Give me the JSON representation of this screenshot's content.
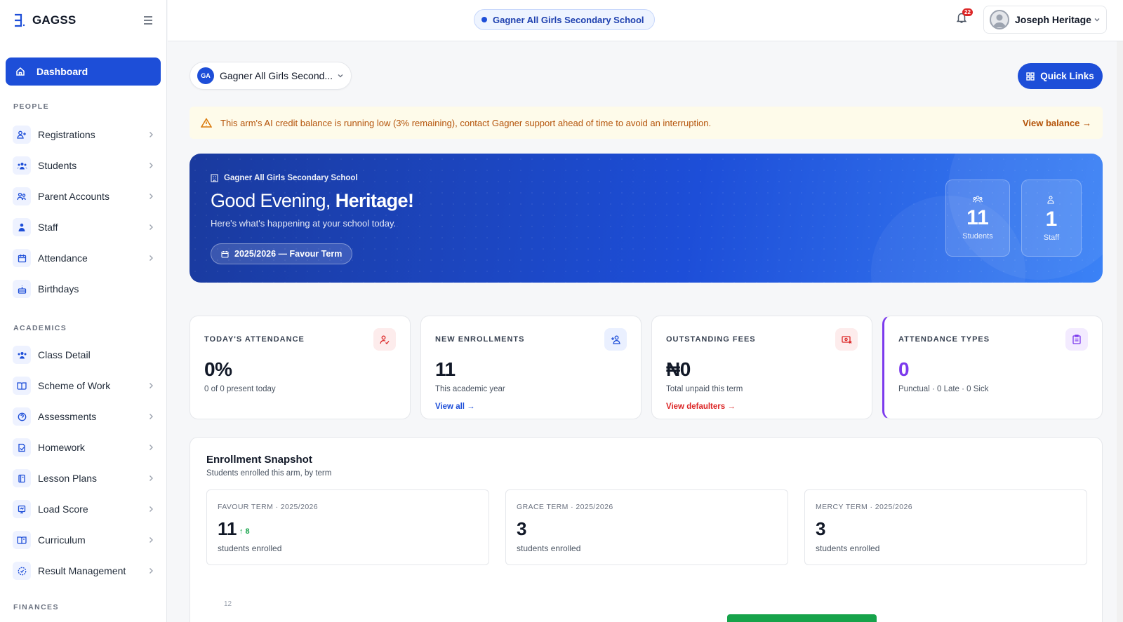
{
  "brand": {
    "name": "GAGSS"
  },
  "sidebar": {
    "dashboard_label": "Dashboard",
    "sections": {
      "people": "PEOPLE",
      "academics": "ACADEMICS",
      "finances": "FINANCES"
    },
    "people_items": [
      {
        "label": "Registrations",
        "icon": "user-plus-icon"
      },
      {
        "label": "Students",
        "icon": "users-icon"
      },
      {
        "label": "Parent Accounts",
        "icon": "parents-icon"
      },
      {
        "label": "Staff",
        "icon": "staff-icon"
      },
      {
        "label": "Attendance",
        "icon": "calendar-icon"
      },
      {
        "label": "Birthdays",
        "icon": "cake-icon"
      }
    ],
    "academic_items": [
      {
        "label": "Class Detail",
        "icon": "class-icon"
      },
      {
        "label": "Scheme of Work",
        "icon": "book-open-icon"
      },
      {
        "label": "Assessments",
        "icon": "question-icon"
      },
      {
        "label": "Homework",
        "icon": "homework-icon"
      },
      {
        "label": "Lesson Plans",
        "icon": "notebook-icon"
      },
      {
        "label": "Load Score",
        "icon": "score-icon"
      },
      {
        "label": "Curriculum",
        "icon": "book-icon"
      },
      {
        "label": "Result Management",
        "icon": "result-icon"
      }
    ]
  },
  "topbar": {
    "school_name": "Gagner All Girls Secondary School",
    "notification_count": "22",
    "user_name": "Joseph Heritage"
  },
  "main": {
    "school_select": {
      "initials": "GA",
      "label": "Gagner All Girls Second..."
    },
    "quick_links_label": "Quick Links",
    "alert": {
      "message": "This arm's AI credit balance is running low (3% remaining), contact Gagner support ahead of time to avoid an interruption.",
      "link": "View balance →"
    },
    "hero": {
      "school": "Gagner All Girls Secondary School",
      "greeting": "Good Evening,",
      "name": "Heritage!",
      "subtitle": "Here's what's happening at your school today.",
      "term": "2025/2026 — Favour Term",
      "stats": [
        {
          "value": "11",
          "label": "Students"
        },
        {
          "value": "1",
          "label": "Staff"
        }
      ]
    },
    "kpis": [
      {
        "title": "TODAY'S ATTENDANCE",
        "value": "0%",
        "desc": "0 of 0 present today",
        "link": ""
      },
      {
        "title": "NEW ENROLLMENTS",
        "value": "11",
        "desc": "This academic year",
        "link": "View all →"
      },
      {
        "title": "OUTSTANDING FEES",
        "value": "₦0",
        "desc": "Total unpaid this term",
        "link": "View defaulters →"
      },
      {
        "title": "ATTENDANCE TYPES",
        "value": "0",
        "desc": "Punctual · 0 Late · 0 Sick",
        "link": ""
      }
    ],
    "snapshot": {
      "title": "Enrollment Snapshot",
      "subtitle": "Students enrolled this arm, by term",
      "terms": [
        {
          "term": "FAVOUR TERM · 2025/2026",
          "count": "11",
          "change": "↑ 8",
          "label": "students enrolled"
        },
        {
          "term": "GRACE TERM · 2025/2026",
          "count": "3",
          "change": "",
          "label": "students enrolled"
        },
        {
          "term": "MERCY TERM · 2025/2026",
          "count": "3",
          "change": "",
          "label": "students enrolled"
        }
      ],
      "axis_top_tick": "12"
    }
  },
  "colors": {
    "primary": "#1d4ed8",
    "alert_text": "#b45309",
    "danger": "#dc2626",
    "purple": "#7c3aed",
    "success": "#16a34a"
  }
}
